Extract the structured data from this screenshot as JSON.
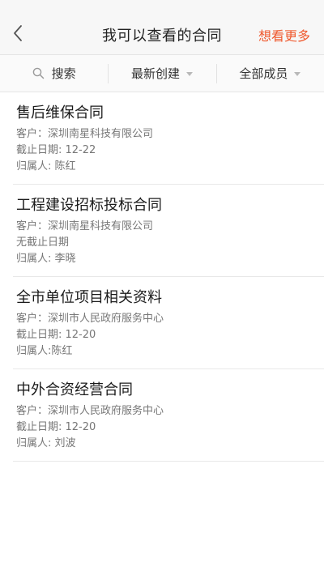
{
  "nav": {
    "title": "我可以查看的合同",
    "more_label": "想看更多",
    "accent_color": "#ef5a2f"
  },
  "filters": {
    "search_label": "搜索",
    "sort_label": "最新创建",
    "members_label": "全部成员"
  },
  "contracts": [
    {
      "name": "售后维保合同",
      "customer": "客户：深圳南星科技有限公司",
      "deadline": "截止日期: 12-22",
      "owner": "归属人: 陈红"
    },
    {
      "name": "工程建设招标投标合同",
      "customer": "客户：深圳南星科技有限公司",
      "deadline": "无截止日期",
      "owner": "归属人: 李晓"
    },
    {
      "name": "全市单位项目相关资料",
      "customer": "客户：深圳市人民政府服务中心",
      "deadline": "截止日期: 12-20",
      "owner": "归属人:陈红"
    },
    {
      "name": "中外合资经营合同",
      "customer": "客户：深圳市人民政府服务中心",
      "deadline": "截止日期: 12-20",
      "owner": "归属人: 刘波"
    }
  ]
}
